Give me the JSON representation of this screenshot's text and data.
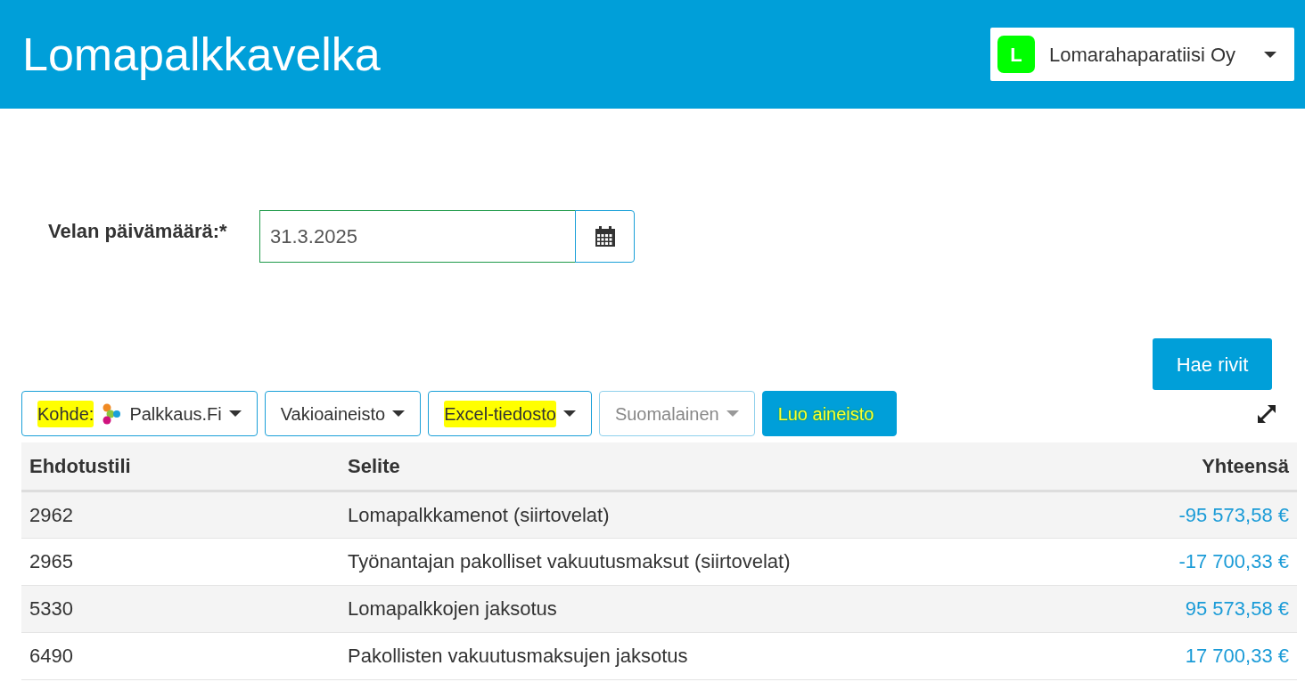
{
  "header": {
    "title": "Lomapalkkavelka",
    "company": {
      "initial": "L",
      "name": "Lomarahaparatiisi Oy"
    }
  },
  "form": {
    "label": "Velan päivämäärä:*",
    "date": "31.3.2025"
  },
  "fetch_button": "Hae rivit",
  "toolbar": [
    {
      "kind": "dropdown",
      "prefix": "Kohde:",
      "prefix_highlighted": true,
      "label": "Palkkaus.Fi",
      "logo": true,
      "highlighted": false,
      "disabled": false
    },
    {
      "kind": "dropdown",
      "label": "Vakioaineisto",
      "logo": false,
      "highlighted": false,
      "disabled": false
    },
    {
      "kind": "dropdown",
      "label": "Excel-tiedosto",
      "logo": false,
      "highlighted": true,
      "disabled": false
    },
    {
      "kind": "dropdown",
      "label": "Suomalainen",
      "logo": false,
      "highlighted": false,
      "disabled": true
    },
    {
      "kind": "primary",
      "label": "Luo aineisto",
      "highlighted": true,
      "disabled": false
    }
  ],
  "table": {
    "columns": [
      "Ehdotustili",
      "Selite",
      "Yhteensä"
    ],
    "rows": [
      [
        "2962",
        "Lomapalkkamenot (siirtovelat)",
        "-95 573,58 €"
      ],
      [
        "2965",
        "Työnantajan pakolliset vakuutusmaksut (siirtovelat)",
        "-17 700,33 €"
      ],
      [
        "5330",
        "Lomapalkkojen jaksotus",
        "95 573,58 €"
      ],
      [
        "6490",
        "Pakollisten vakuutusmaksujen jaksotus",
        "17 700,33 €"
      ]
    ]
  }
}
